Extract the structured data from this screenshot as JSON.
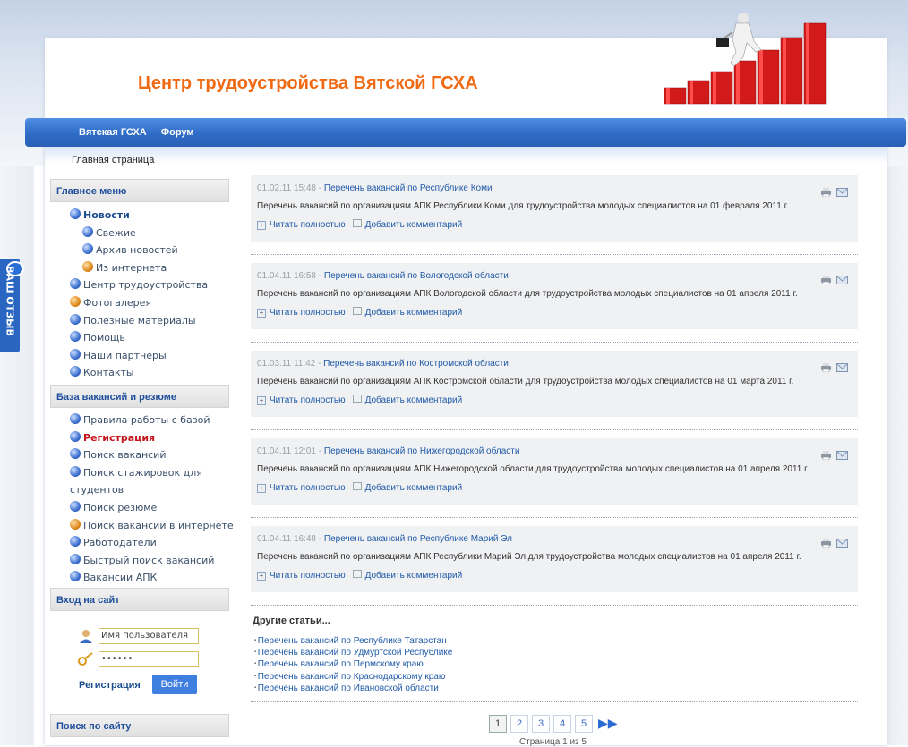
{
  "site_title": "Центр трудоустройства Вятской ГСХА",
  "nav": [
    "Вятская ГСХА",
    "Форум"
  ],
  "breadcrumb": "Главная страница",
  "feedback_label": "ВАШ ОТЗЫВ",
  "main_menu": {
    "title": "Главное меню",
    "items": [
      {
        "label": "Новости",
        "style": "bold",
        "icon": "blue-globe-icon"
      },
      {
        "label": "Свежие",
        "style": "sub",
        "icon": "blue-globe-icon"
      },
      {
        "label": "Архив новостей",
        "style": "sub",
        "icon": "blue-globe-icon"
      },
      {
        "label": "Из интернета",
        "style": "sub",
        "icon": "orange-globe-icon"
      },
      {
        "label": "Центр трудоустройства",
        "style": "",
        "icon": "blue-globe-icon"
      },
      {
        "label": "Фотогалерея",
        "style": "",
        "icon": "orange-globe-icon"
      },
      {
        "label": "Полезные материалы",
        "style": "",
        "icon": "blue-globe-icon"
      },
      {
        "label": "Помощь",
        "style": "",
        "icon": "blue-globe-icon"
      },
      {
        "label": "Наши партнеры",
        "style": "",
        "icon": "blue-globe-icon"
      },
      {
        "label": "Контакты",
        "style": "",
        "icon": "blue-globe-icon"
      }
    ]
  },
  "base_menu": {
    "title": "База вакансий и резюме",
    "items": [
      {
        "label": "Правила работы с базой",
        "style": "",
        "icon": "blue-globe-icon"
      },
      {
        "label": "Регистрация",
        "style": "red",
        "icon": "blue-globe-icon"
      },
      {
        "label": "Поиск вакансий",
        "style": "",
        "icon": "blue-globe-icon"
      },
      {
        "label": "Поиск стажировок для студентов",
        "style": "wrap",
        "icon": "blue-globe-icon"
      },
      {
        "label": "Поиск резюме",
        "style": "",
        "icon": "blue-globe-icon"
      },
      {
        "label": "Поиск вакансий в интернете",
        "style": "",
        "icon": "orange-globe-icon"
      },
      {
        "label": "Работодатели",
        "style": "",
        "icon": "blue-globe-icon"
      },
      {
        "label": "Быстрый поиск вакансий",
        "style": "",
        "icon": "blue-globe-icon"
      },
      {
        "label": "Вакансии АПК",
        "style": "",
        "icon": "blue-globe-icon"
      }
    ]
  },
  "login": {
    "title": "Вход на сайт",
    "username_placeholder": "Имя пользователя",
    "password_value": "••••••",
    "register_label": "Регистрация",
    "submit_label": "Войти"
  },
  "search_title": "Поиск по сайту",
  "articles": [
    {
      "date": "01.02.11 15:48",
      "title": "Перечень вакансий по Республике Коми",
      "text": "Перечень вакансий по организациям АПК Республики Коми для трудоустройства молодых специалистов на 01 февраля 2011 г."
    },
    {
      "date": "01.04.11 16:58",
      "title": "Перечень вакансий по Вологодской области",
      "text": "Перечень вакансий по организациям АПК Вологодской области для трудоустройства молодых специалистов на 01 апреля 2011 г."
    },
    {
      "date": "01.03.11 11:42",
      "title": "Перечень вакансий по Костромской области",
      "text": "Перечень вакансий по организациям АПК Костромской области для трудоустройства молодых специалистов на 01 марта 2011 г."
    },
    {
      "date": "01.04.11 12:01",
      "title": "Перечень вакансий по Нижегородской области",
      "text": "Перечень вакансий по организациям АПК Нижегородской области для трудоустройства молодых специалистов на 01 апреля 2011 г."
    },
    {
      "date": "01.04.11 16:48",
      "title": "Перечень вакансий по Республике Марий Эл",
      "text": "Перечень вакансий по организациям АПК Республики Марий Эл для трудоустройства молодых специалистов на 01 апреля 2011 г."
    }
  ],
  "article_actions": {
    "read_more": "Читать полностью",
    "add_comment": "Добавить комментарий"
  },
  "other_articles": {
    "title": "Другие статьи...",
    "items": [
      "Перечень вакансий по Республике Татарстан",
      "Перечень вакансий по Удмуртской Республике",
      "Перечень вакансий по Пермскому краю",
      "Перечень вакансий по Краснодарскому краю",
      "Перечень вакансий по Ивановской области"
    ]
  },
  "pagination": {
    "pages": [
      "1",
      "2",
      "3",
      "4",
      "5"
    ],
    "current": "1",
    "caption": "Страница 1 из 5"
  }
}
